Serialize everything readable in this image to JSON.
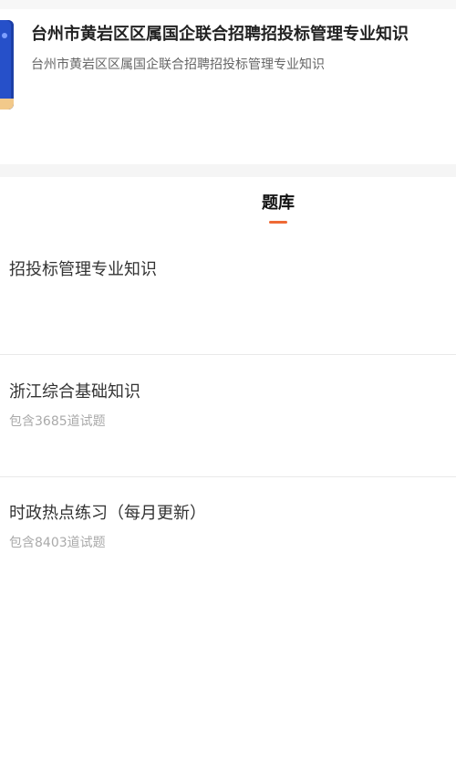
{
  "course": {
    "title": "台州市黄岩区区属国企联合招聘招投标管理专业知识",
    "subtitle": "台州市黄岩区区属国企联合招聘招投标管理专业知识"
  },
  "tabs": {
    "active_label": "题库",
    "accent_color": "#ef6a35"
  },
  "question_banks": [
    {
      "name": "招投标管理专业知识",
      "count_text": ""
    },
    {
      "name": "浙江综合基础知识",
      "count_text": "包含3685道试题"
    },
    {
      "name": "时政热点练习（每月更新）",
      "count_text": "包含8403道试题"
    }
  ]
}
